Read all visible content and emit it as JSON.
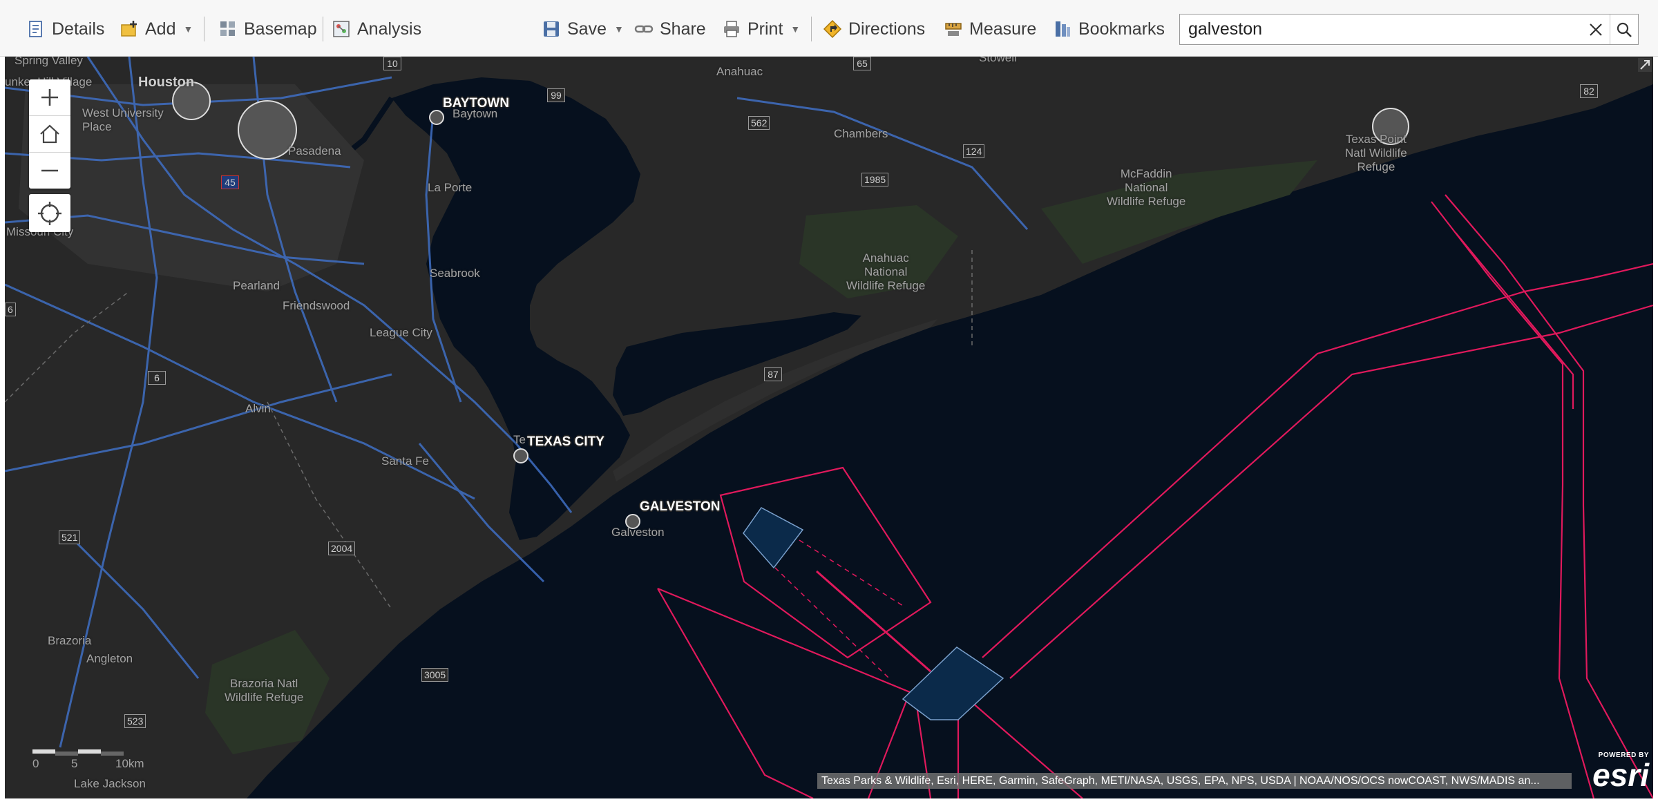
{
  "toolbar": {
    "details": "Details",
    "add": "Add",
    "basemap": "Basemap",
    "analysis": "Analysis",
    "save": "Save",
    "share": "Share",
    "print": "Print",
    "directions": "Directions",
    "measure": "Measure",
    "bookmarks": "Bookmarks"
  },
  "search": {
    "value": "galveston",
    "clear_icon": "close-icon",
    "search_icon": "search-icon"
  },
  "map": {
    "controls": {
      "zoom_in_icon": "plus-icon",
      "home_icon": "home-icon",
      "zoom_out_icon": "minus-icon",
      "locate_icon": "locate-icon"
    },
    "city_labels": {
      "baytown": "BAYTOWN",
      "texas_city": "TEXAS CITY",
      "galveston": "GALVESTON"
    },
    "place_labels": {
      "spring_valley": "Spring Valley",
      "bunker_hill": "unker Hill Village",
      "houston": "Houston",
      "west_university": "West University",
      "place": "Place",
      "pasadena": "Pasadena",
      "baytown": "Baytown",
      "la_porte": "La Porte",
      "missouri_city": "Missouri City",
      "pearland": "Pearland",
      "friendswood": "Friendswood",
      "league_city": "League City",
      "seabrook": "Seabrook",
      "alvin": "Alvin",
      "santa_fe": "Santa Fe",
      "texas_city_small": "Te",
      "galveston": "Galveston",
      "brazoria": "Brazoria",
      "angleton": "Angleton",
      "brazoria_refuge_1": "Brazoria Natl",
      "brazoria_refuge_2": "Wildlife Refuge",
      "lake_jackson": "Lake Jackson",
      "anahuac": "Anahuac",
      "chambers": "Chambers",
      "anahuac_refuge_1": "Anahuac",
      "anahuac_refuge_2": "National",
      "anahuac_refuge_3": "Wildlife Refuge",
      "mcfaddin_1": "McFaddin",
      "mcfaddin_2": "National",
      "mcfaddin_3": "Wildlife Refuge",
      "texas_point_1": "Texas Point",
      "texas_point_2": "Natl Wildlife",
      "texas_point_3": "Refuge",
      "stowell": "Stowell"
    },
    "highways": {
      "i10": "10",
      "i45": "45",
      "us99": "99",
      "r65": "65",
      "r562": "562",
      "r124": "124",
      "r1985": "1985",
      "r82": "82",
      "r87": "87",
      "r6": "6",
      "r521": "521",
      "r2004": "2004",
      "r3005": "3005",
      "r523": "523",
      "r6_edge": "6"
    },
    "scale": {
      "l0": "0",
      "l5": "5",
      "l10": "10km"
    },
    "attribution": "Texas Parks & Wildlife, Esri, HERE, Garmin, SafeGraph, METI/NASA, USGS, EPA, NPS, USDA | NOAA/NOS/OCS nowCOAST, NWS/MADIS an...",
    "esri_powered": "POWERED BY",
    "esri_name": "esri",
    "colors": {
      "water": "#06101e",
      "land": "#282828",
      "roads": "#3f6fc4",
      "zone_lines": "#e0195c",
      "zone_fill": "#0b2a4a"
    }
  }
}
